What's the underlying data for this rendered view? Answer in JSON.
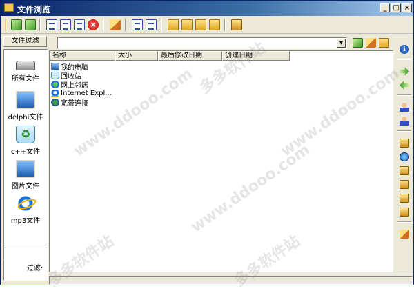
{
  "window": {
    "title": "文件浏览",
    "min_glyph": "_",
    "max_glyph": "□",
    "close_glyph": "×"
  },
  "toolbar": {
    "icons": [
      "refresh-icon",
      "export-icon",
      "copy-icon",
      "view-icon",
      "properties-icon",
      "delete-icon",
      "edit-icon",
      "page-icon",
      "bookmark-icon",
      "folder-open-icon",
      "folder-move-icon",
      "folder-copy-icon",
      "folder-new-icon",
      "settings-icon"
    ]
  },
  "left_panel": {
    "header": "文件过滤",
    "items": [
      {
        "label": "所有文件",
        "icon": "drive-icon"
      },
      {
        "label": "delphi文件",
        "icon": "monitor-icon"
      },
      {
        "label": "c++文件",
        "icon": "recycle-icon"
      },
      {
        "label": "图片文件",
        "icon": "monitor-icon"
      },
      {
        "label": "mp3文件",
        "icon": "ie-icon"
      }
    ],
    "filter_label": "过滤:"
  },
  "path": {
    "value": "",
    "dropdown_glyph": "▼"
  },
  "list": {
    "columns": [
      "名称",
      "大小",
      "最后修改日期",
      "创建日期"
    ],
    "rows": [
      {
        "name": "我的电脑",
        "icon": "computer-icon"
      },
      {
        "name": "回收站",
        "icon": "recycle-bin-icon"
      },
      {
        "name": "网上邻居",
        "icon": "network-icon"
      },
      {
        "name": "Internet Expl...",
        "icon": "ie-icon"
      },
      {
        "name": "宽带连接",
        "icon": "broadband-icon"
      }
    ]
  },
  "right_panel": {
    "info_glyph": "i"
  },
  "watermarks": [
    "多多软件站",
    "www.ddooo.com"
  ],
  "colors": {
    "titlebar": "#0a246a",
    "chrome": "#ece9d8",
    "accent": "#3a9a20"
  }
}
